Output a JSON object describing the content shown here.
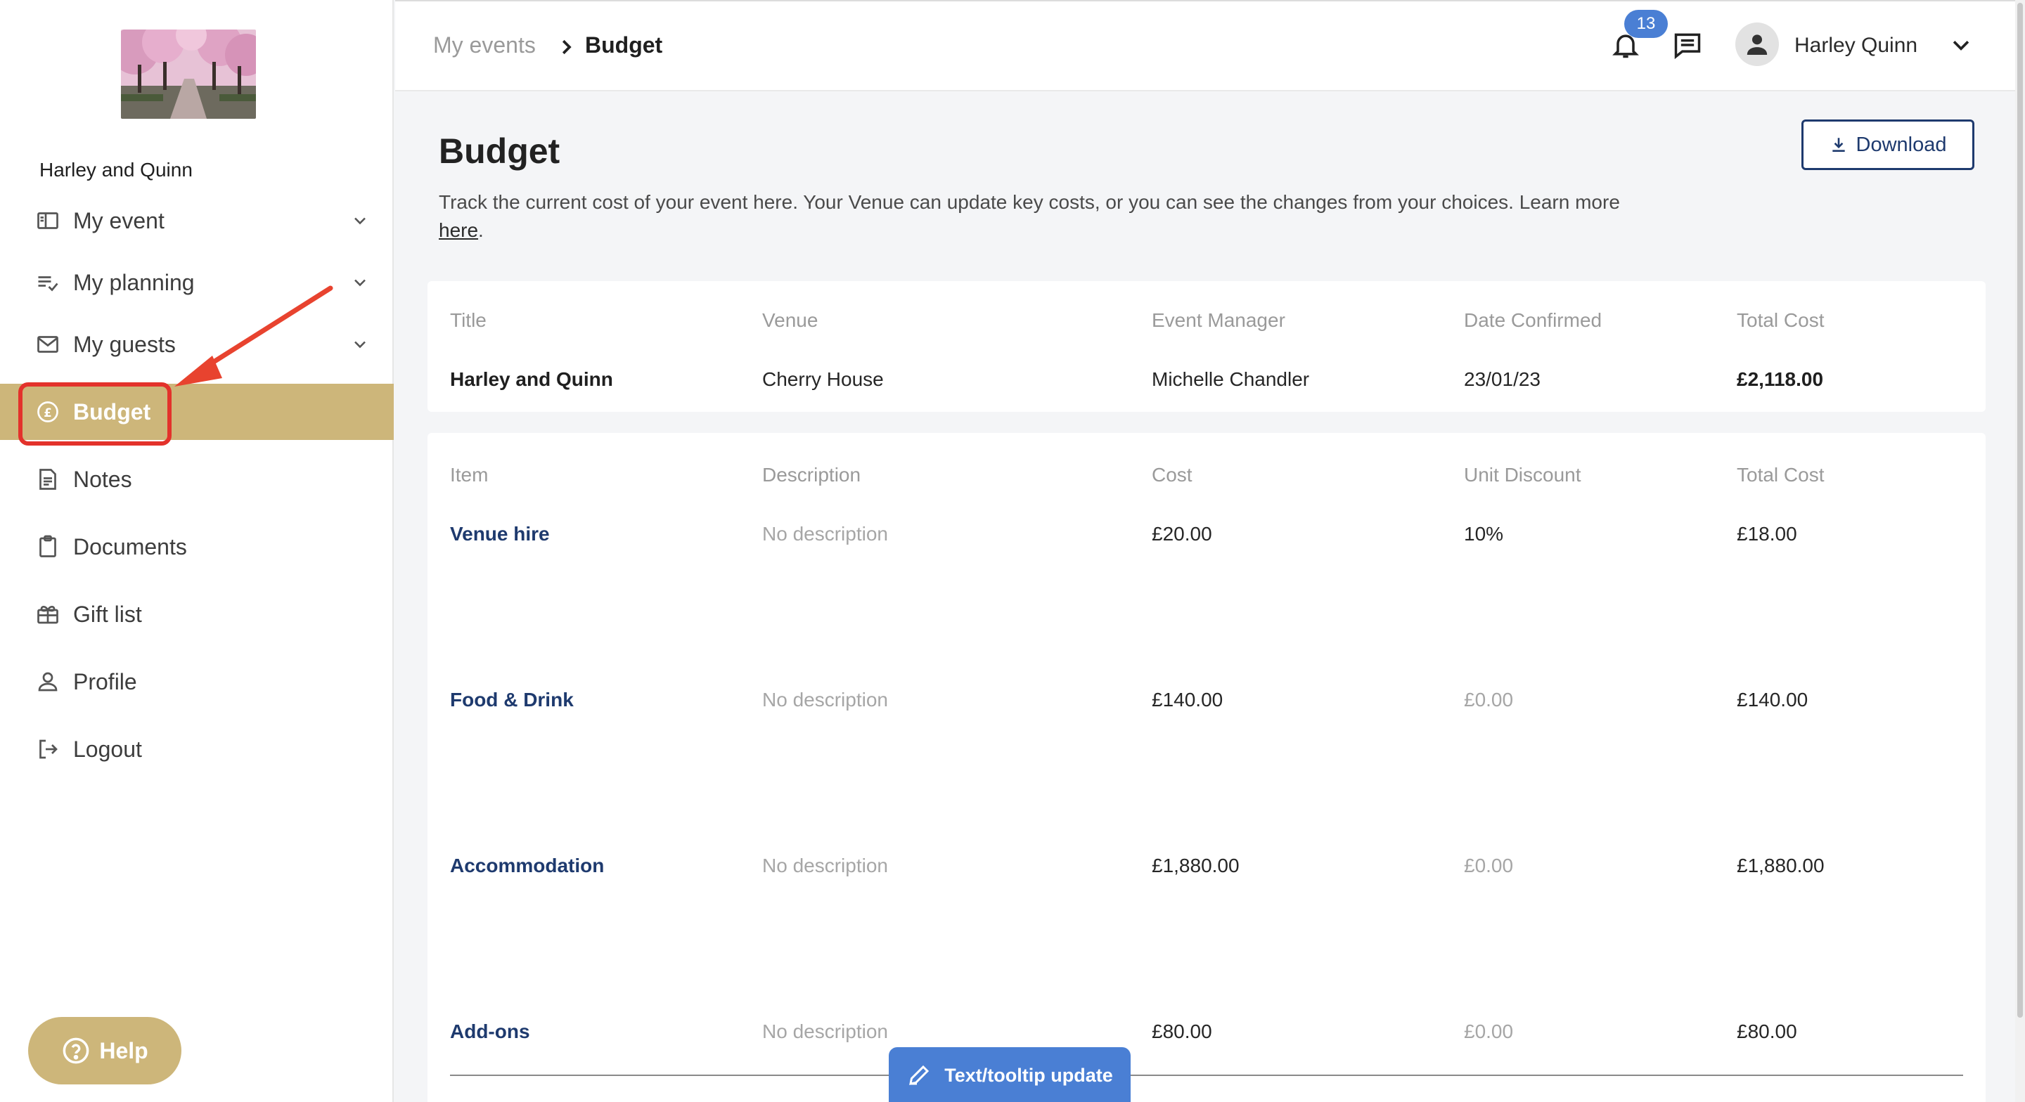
{
  "sidebar": {
    "event_name": "Harley and Quinn",
    "items": [
      {
        "label": "My event",
        "icon": "layout-icon",
        "has_chevron": true
      },
      {
        "label": "My planning",
        "icon": "checklist-icon",
        "has_chevron": true
      },
      {
        "label": "My guests",
        "icon": "mail-icon",
        "has_chevron": true
      },
      {
        "label": "Budget",
        "icon": "pound-circle-icon",
        "active": true
      },
      {
        "label": "Notes",
        "icon": "note-icon"
      },
      {
        "label": "Documents",
        "icon": "clipboard-icon"
      },
      {
        "label": "Gift list",
        "icon": "gift-icon"
      },
      {
        "label": "Profile",
        "icon": "user-icon"
      },
      {
        "label": "Logout",
        "icon": "logout-icon"
      }
    ],
    "help_label": "Help",
    "active_color": "#cdb67a"
  },
  "header": {
    "breadcrumb": [
      "My events",
      "Budget"
    ],
    "notification_count": "13",
    "user_name": "Harley Quinn"
  },
  "main": {
    "title": "Budget",
    "description": "Track the current cost of your event here. Your Venue can update key costs, or you can see the changes from your choices. Learn more",
    "description_link": "here",
    "description_end": ".",
    "download_label": "Download"
  },
  "summary": {
    "headers": [
      "Title",
      "Venue",
      "Event Manager",
      "Date Confirmed",
      "Total Cost"
    ],
    "values": [
      "Harley and Quinn",
      "Cherry House",
      "Michelle Chandler",
      "23/01/23",
      "£2,118.00"
    ]
  },
  "items": {
    "headers": [
      "Item",
      "Description",
      "Cost",
      "Unit Discount",
      "Total Cost"
    ],
    "rows": [
      {
        "item": "Venue hire",
        "description": "No description",
        "cost": "£20.00",
        "discount": "10%",
        "total": "£18.00"
      },
      {
        "item": "Food & Drink",
        "description": "No description",
        "cost": "£140.00",
        "discount": "£0.00",
        "total": "£140.00"
      },
      {
        "item": "Accommodation",
        "description": "No description",
        "cost": "£1,880.00",
        "discount": "£0.00",
        "total": "£1,880.00"
      },
      {
        "item": "Add-ons",
        "description": "No description",
        "cost": "£80.00",
        "discount": "£0.00",
        "total": "£80.00"
      }
    ]
  },
  "tooltip_button": "Text/tooltip update",
  "colors": {
    "accent": "#cdb67a",
    "link": "#1e3a6e",
    "badge": "#4a7fd4",
    "annotation": "#e3322b"
  }
}
